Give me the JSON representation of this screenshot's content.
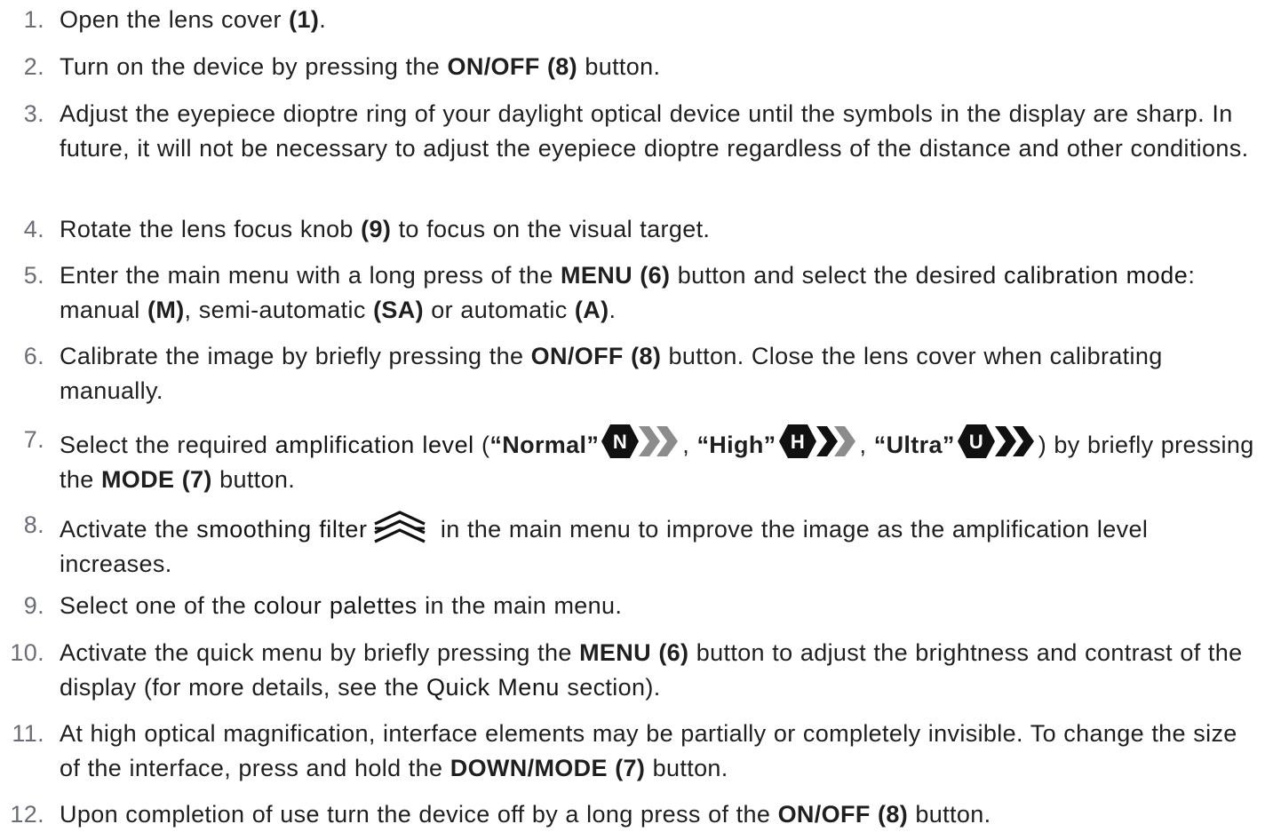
{
  "steps": [
    {
      "num": "1.",
      "t1": "Open the lens cover ",
      "b1": "(1)",
      "t2": "."
    },
    {
      "num": "2.",
      "t1": "Turn on the device by pressing the ",
      "b1": "ON/OFF (8)",
      "t2": " button."
    },
    {
      "num": "3.",
      "t1": "Adjust the eyepiece dioptre ring of your daylight optical device until the symbols in the display are sharp. In future, it will not be necessary to adjust the eyepiece dioptre regardless of the distance and other conditions."
    },
    {
      "num": "4.",
      "t1": "Rotate the lens focus knob ",
      "b1": "(9)",
      "t2": " to focus on the visual target."
    },
    {
      "num": "5.",
      "t1": "Enter the main menu with a long press of the ",
      "b1": "MENU (6)",
      "t2": " button and select the desired ",
      "term": "calibration mode",
      "t3": ": manual ",
      "b2": "(M)",
      "t4": ", semi-automatic ",
      "b3": "(SA)",
      "t5": " or automatic ",
      "b4": "(A)",
      "t6": "."
    },
    {
      "num": "6.",
      "t1": "Calibrate the image by briefly pressing the ",
      "b1": "ON/OFF (8)",
      "t2": " button. Close the lens cover when calibrating manually."
    },
    {
      "num": "7.",
      "t1": "Select the required ",
      "term": "amplification level",
      "t2": " (",
      "b1": "“Normal”",
      "i1": "N",
      "t3": ", ",
      "b2": "“High”",
      "i2": "H",
      "t4": ", ",
      "b3": "“Ultra”",
      "i3": "U",
      "t5": ") by briefly pressing the ",
      "b4": "MODE (7)",
      "t6": " button."
    },
    {
      "num": "8.",
      "t1": "Activate the ",
      "term": "smoothing filter",
      "t2": " in the main menu to improve the image as the amplification level increases."
    },
    {
      "num": "9.",
      "t1": "Select one of the ",
      "term": "colour palettes",
      "t2": " in the main menu."
    },
    {
      "num": "10.",
      "t1": "Activate the quick menu by briefly pressing the ",
      "b1": "MENU (6)",
      "t2": " button to adjust the brightness and contrast of the display (for more details, see the ",
      "term": "Quick Menu",
      "t3": " section)."
    },
    {
      "num": "11.",
      "t1": "At high optical magnification, interface elements may be partially or completely invisible. To change the size of the interface, press and hold the ",
      "b1": "DOWN/MODE (7)",
      "t2": " button."
    },
    {
      "num": "12.",
      "t1": "Upon completion of use turn the device off by a long press of the ",
      "b1": "ON/OFF (8)",
      "t2": " button."
    }
  ],
  "icons": {
    "normal": "amplification-normal-icon",
    "high": "amplification-high-icon",
    "ultra": "amplification-ultra-icon",
    "smoothing": "smoothing-filter-icon"
  },
  "colors": {
    "text": "#1f1f1f",
    "number": "#6b6e78",
    "icon_dark": "#111111",
    "icon_grey": "#8c8c8c"
  }
}
